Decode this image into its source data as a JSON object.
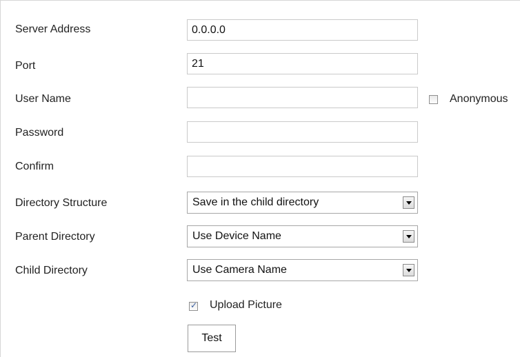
{
  "fields": {
    "server_address": {
      "label": "Server Address",
      "value": "0.0.0.0"
    },
    "port": {
      "label": "Port",
      "value": "21"
    },
    "user_name": {
      "label": "User Name",
      "value": ""
    },
    "password": {
      "label": "Password",
      "value": ""
    },
    "confirm": {
      "label": "Confirm",
      "value": ""
    }
  },
  "anonymous": {
    "label": "Anonymous",
    "checked": false
  },
  "directory_structure": {
    "label": "Directory Structure",
    "selected": "Save in the child directory"
  },
  "parent_directory": {
    "label": "Parent Directory",
    "selected": "Use Device Name"
  },
  "child_directory": {
    "label": "Child Directory",
    "selected": "Use Camera Name"
  },
  "upload_picture": {
    "label": "Upload Picture",
    "checked": true
  },
  "test_button": {
    "label": "Test"
  }
}
